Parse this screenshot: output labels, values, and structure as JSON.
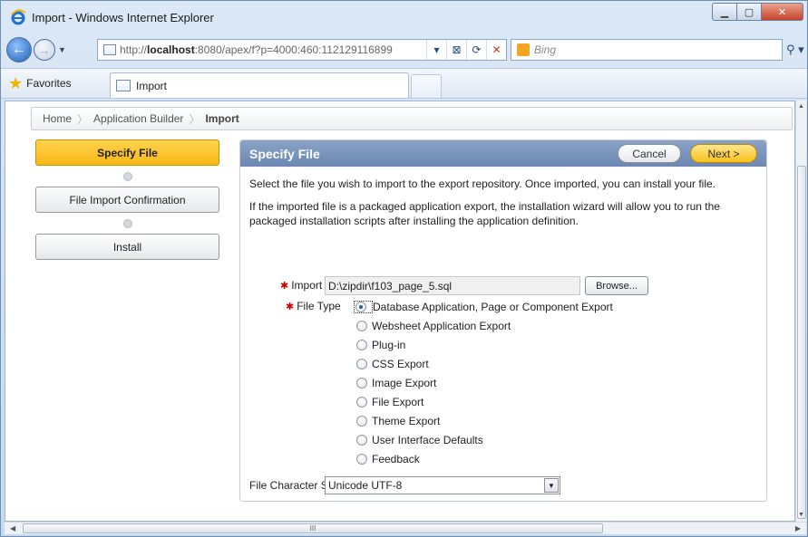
{
  "window": {
    "title": "Import - Windows Internet Explorer"
  },
  "address_bar": {
    "url_prefix": "http://",
    "url_host": "localhost",
    "url_rest": ":8080/apex/f?p=4000:460:112129116899"
  },
  "search": {
    "placeholder": "Bing"
  },
  "favorites": {
    "label": "Favorites"
  },
  "tab": {
    "label": "Import"
  },
  "breadcrumb": {
    "items": [
      "Home",
      "Application Builder",
      "Import"
    ]
  },
  "wizard": {
    "steps": [
      "Specify File",
      "File Import Confirmation",
      "Install"
    ]
  },
  "region": {
    "title": "Specify File",
    "cancel_label": "Cancel",
    "next_label": "Next >",
    "para1": "Select the file you wish to import to the export repository. Once imported, you can install your file.",
    "para2": "If the imported file is a packaged application export, the installation wizard will allow you to run the packaged installation scripts after installing the application definition."
  },
  "form": {
    "import_file_label": "Import file",
    "import_file_value": "D:\\zipdir\\f103_page_5.sql",
    "browse_label": "Browse...",
    "file_type_label": "File Type",
    "file_type_options": [
      "Database Application, Page or Component Export",
      "Websheet Application Export",
      "Plug-in",
      "CSS Export",
      "Image Export",
      "File Export",
      "Theme Export",
      "User Interface Defaults",
      "Feedback"
    ],
    "file_type_selected": "Database Application, Page or Component Export",
    "charset_label": "File Character Set",
    "charset_value": "Unicode UTF-8"
  },
  "scrollbar": {
    "h_grip": "III"
  }
}
